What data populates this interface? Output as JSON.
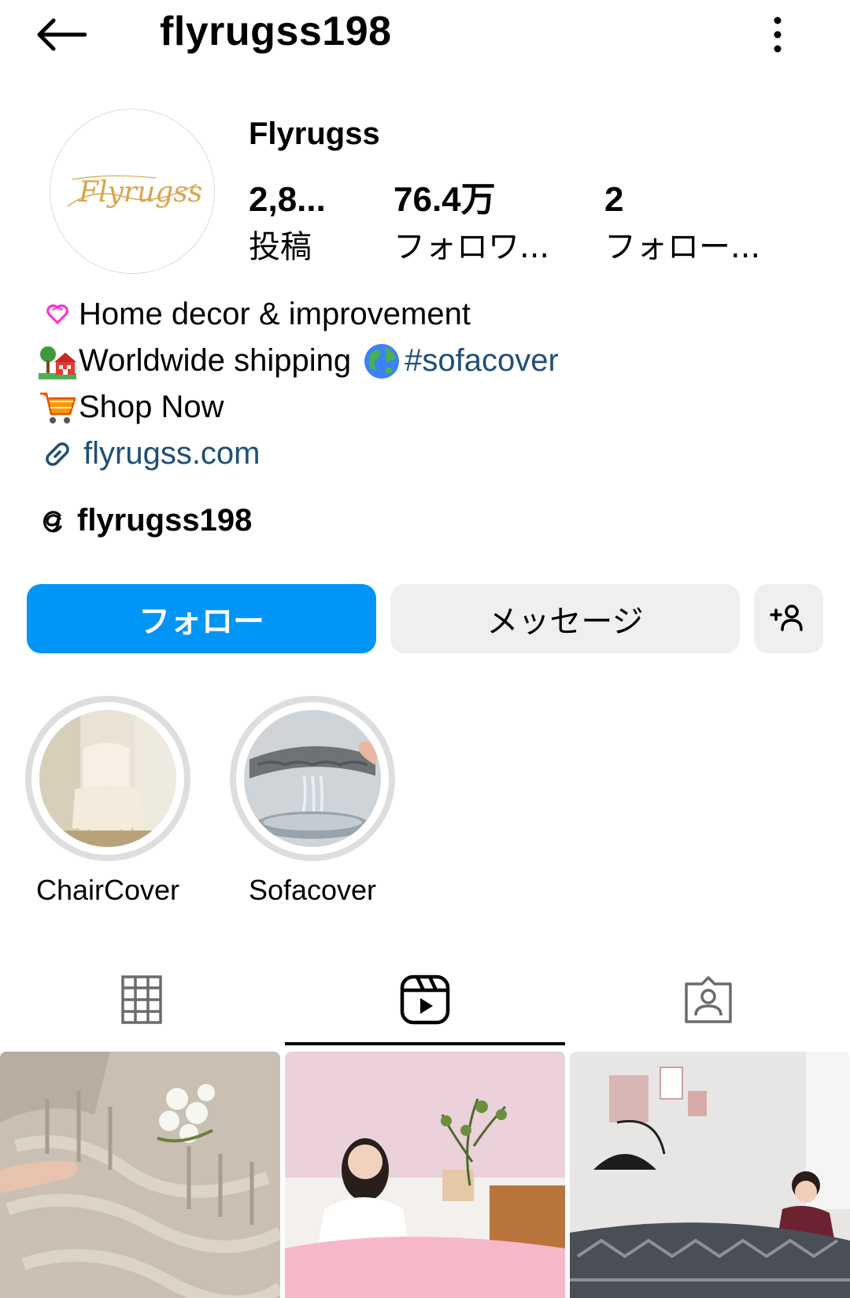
{
  "header": {
    "username": "flyrugss198",
    "back_icon": "arrow-left-icon",
    "more_icon": "more-vertical-icon"
  },
  "profile": {
    "display_name": "Flyrugss",
    "avatar_text": "Flyrugss",
    "stats": [
      {
        "value": "2,8...",
        "label": "投稿"
      },
      {
        "value": "76.4万",
        "label": "フォロワ..."
      },
      {
        "value": "2",
        "label": "フォロー..."
      }
    ]
  },
  "bio": {
    "line1": "Home decor & improvement",
    "line2_text": "Worldwide shipping ",
    "line2_hashtag": "#sofacover",
    "line3": "Shop Now",
    "link": "flyrugss.com",
    "icons": [
      "double-heart-emoji",
      "house-with-tree-emoji",
      "globe-emoji",
      "shopping-cart-emoji",
      "link-icon"
    ]
  },
  "threads": {
    "handle": "flyrugss198",
    "icon": "threads-icon"
  },
  "actions": {
    "follow": "フォロー",
    "message": "メッセージ",
    "add_user_icon": "add-person-icon"
  },
  "highlights": [
    {
      "label": "ChairCover"
    },
    {
      "label": "Sofacover"
    }
  ],
  "tabs": {
    "items": [
      "grid-icon",
      "reels-icon",
      "tagged-icon"
    ],
    "active": "reels-icon"
  },
  "colors": {
    "accent": "#0095f6",
    "link": "#1f4e79",
    "button_gray": "#efefef",
    "ring_gray": "#dedede"
  }
}
